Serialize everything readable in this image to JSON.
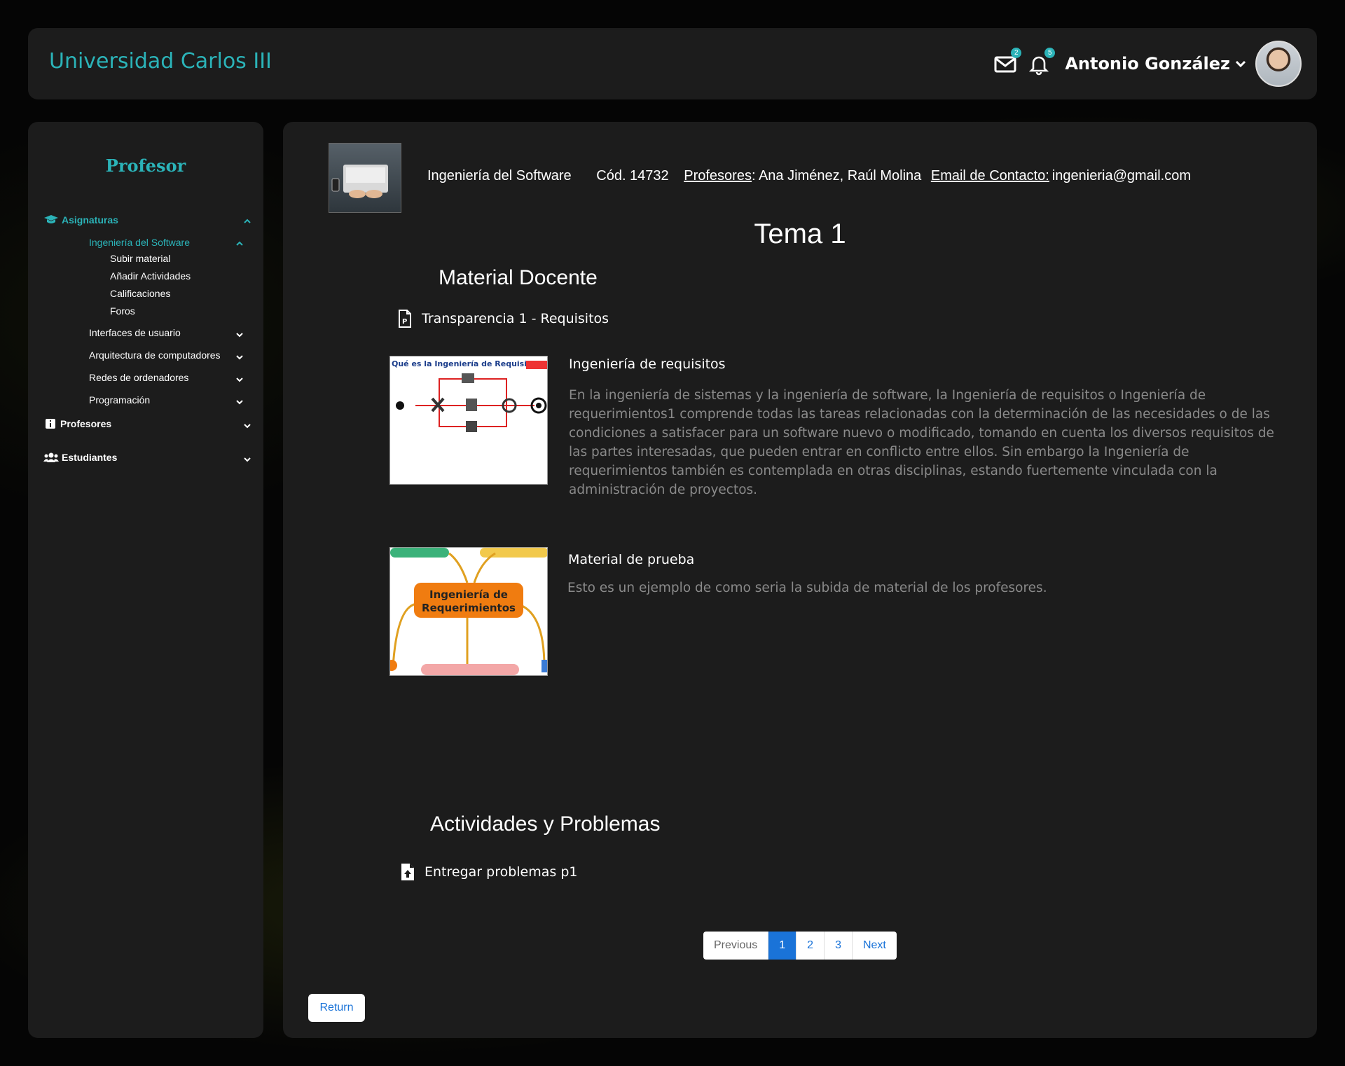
{
  "header": {
    "brand": "Universidad Carlos III",
    "mail_count": "2",
    "notif_count": "5",
    "user_name": "Antonio González"
  },
  "sidebar": {
    "title": "Profesor",
    "asignaturas": "Asignaturas",
    "current_subject": "Ingeniería del Software",
    "sub_items": [
      "Subir material",
      "Añadir Actividades",
      "Calificaciones",
      "Foros"
    ],
    "other_subjects": [
      "Interfaces de usuario",
      "Arquitectura de computadores",
      "Redes de ordenadores",
      "Programación"
    ],
    "profesores": "Profesores",
    "estudiantes": "Estudiantes"
  },
  "course": {
    "name": "Ingeniería del Software",
    "code": "Cód. 14732",
    "teachers_label": "Profesores",
    "teachers": ": Ana Jiménez, Raúl Molina",
    "contact_label": "Email de Contacto:",
    "contact_email": "ingenieria@gmail.com"
  },
  "topic": {
    "title": "Tema 1",
    "material_heading": "Material Docente",
    "file1": "Transparencia 1 - Requisitos",
    "materials": [
      {
        "title": "Ingeniería de requisitos",
        "image_title": "Qué es la Ingeniería de Requisitos?",
        "description": "En la ingeniería de sistemas y la ingeniería de software, la Ingeniería de requisitos o Ingeniería de requerimientos1 comprende todas las tareas relacionadas con la determinación de las necesidades o de las condiciones a satisfacer para un software nuevo o modificado, tomando en cuenta los diversos requisitos de las partes interesadas, que pueden entrar en conflicto entre ellos. Sin embargo la Ingeniería de requerimientos también es contemplada en otras disciplinas, estando fuertemente vinculada con la administración de proyectos."
      },
      {
        "title": "Material de prueba",
        "image_title": "Ingeniería de Requerimientos",
        "description": "Esto es un ejemplo de como seria la subida de material de los profesores."
      }
    ],
    "activities_heading": "Actividades y Problemas",
    "activity1": "Entregar problemas p1"
  },
  "pagination": {
    "previous": "Previous",
    "pages": [
      "1",
      "2",
      "3"
    ],
    "next": "Next"
  },
  "return_label": "Return",
  "colors": {
    "accent": "#2bb3b8",
    "link": "#1a73d8",
    "panel": "#1c1c1c"
  }
}
